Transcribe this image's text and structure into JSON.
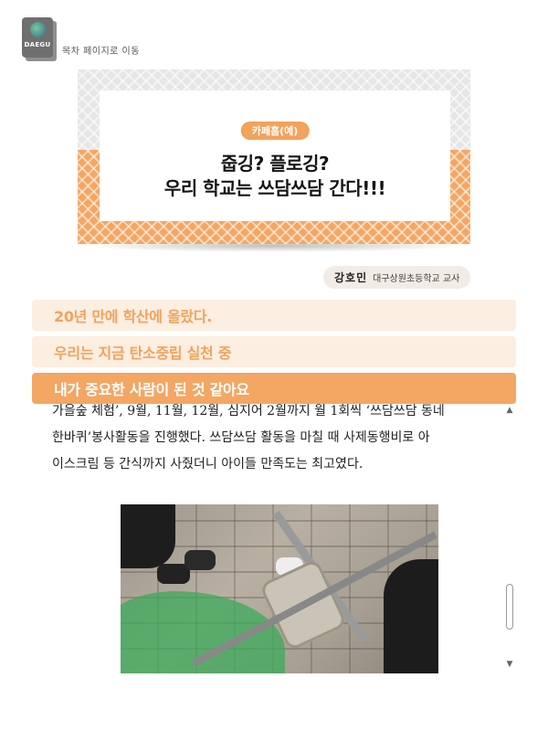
{
  "toc_link": {
    "brand": "DAEGU",
    "label": "목차 페이지로 이동"
  },
  "banner": {
    "tag": "카페홈(예)",
    "title_line1": "줍깅? 플로깅?",
    "title_line2": "우리 학교는 쓰담쓰담 간다!!!"
  },
  "author": {
    "name": "강호민",
    "school": "대구상원초등학교 교사"
  },
  "sections": [
    {
      "label": "20년 만에 학산에 올랐다.",
      "active": false
    },
    {
      "label": "우리는 지금 탄소중립 실천 중",
      "active": false
    },
    {
      "label": "내가 중요한 사람이 된 것 같아요",
      "active": true
    }
  ],
  "body": {
    "lines": [
      "가을숲 체험’, 9월, 11월, 12월, 심지어 2월까지 월 1회씩 ‘쓰담쓰담 동네",
      "한바퀴’봉사활동을 진행했다. 쓰담쓰담 활동을 마칠 때 사제동행비로 아",
      "이스크림 등 간식까지 사줬더니 아이들 만족도는 최고였다."
    ]
  },
  "scrollbar": {
    "up_glyph": "▲",
    "down_glyph": "▼"
  },
  "colors": {
    "accent": "#f4a663",
    "accent_light": "#fdeee2",
    "banner_gray": "#e6e6e6"
  }
}
